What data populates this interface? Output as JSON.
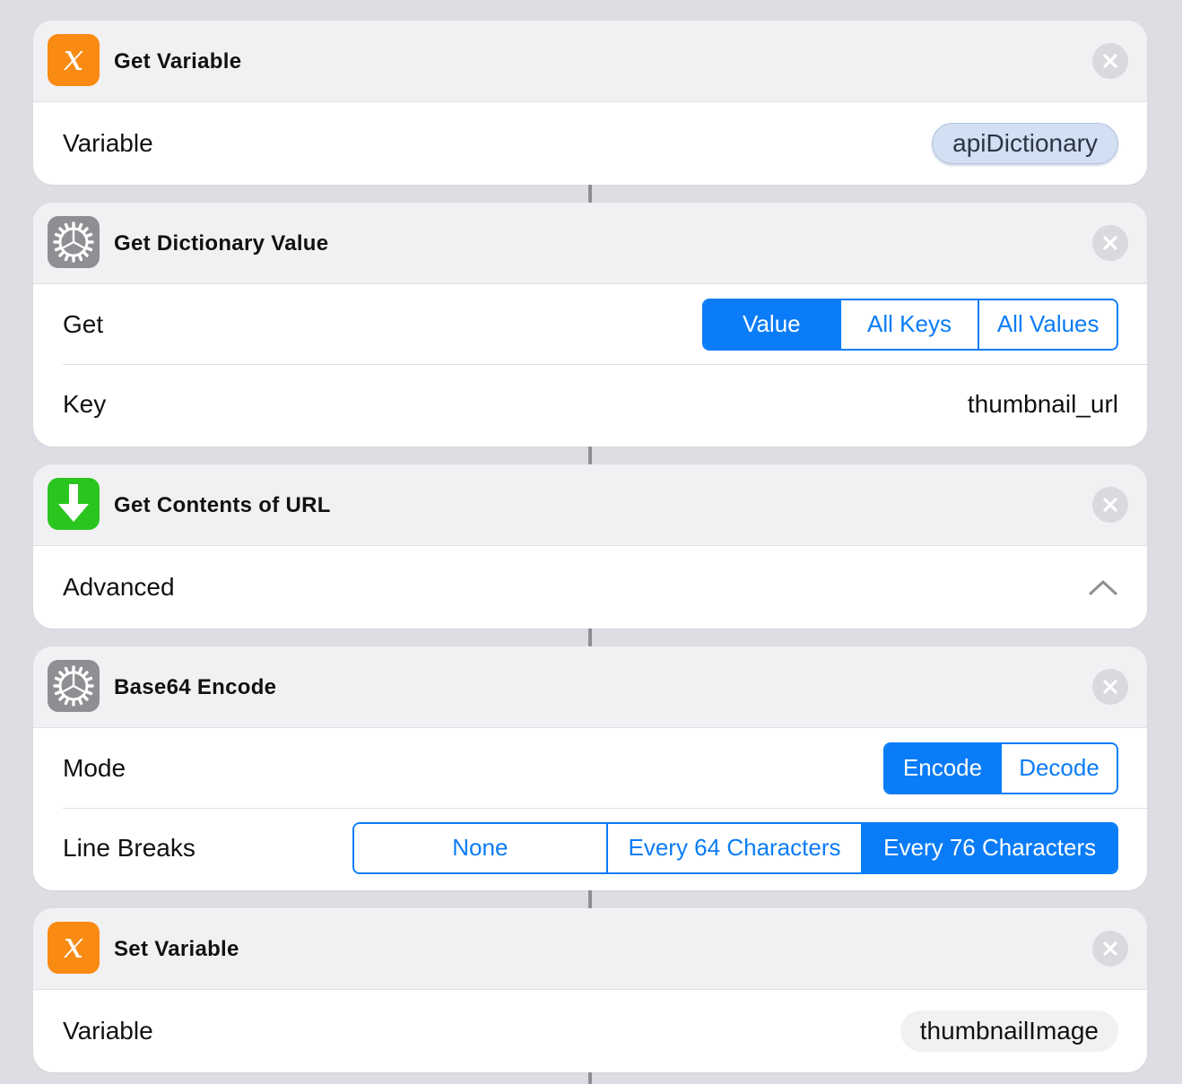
{
  "cards": [
    {
      "title": "Get Variable",
      "icon": "variable-x-icon",
      "icon_color": "#f98a12",
      "rows": [
        {
          "label": "Variable",
          "token": "apiDictionary"
        }
      ]
    },
    {
      "title": "Get Dictionary Value",
      "icon": "gear-icon",
      "icon_color": "#8e8e93",
      "rows": [
        {
          "label": "Get",
          "segments": [
            "Value",
            "All Keys",
            "All Values"
          ],
          "selected": "Value"
        },
        {
          "label": "Key",
          "value": "thumbnail_url"
        }
      ]
    },
    {
      "title": "Get Contents of URL",
      "icon": "download-arrow-icon",
      "icon_color": "#2bc51f",
      "rows": [
        {
          "label": "Advanced",
          "disclosure": "chevron-up-icon"
        }
      ]
    },
    {
      "title": "Base64 Encode",
      "icon": "gear-icon",
      "icon_color": "#8e8e93",
      "rows": [
        {
          "label": "Mode",
          "segments": [
            "Encode",
            "Decode"
          ],
          "selected": "Encode"
        },
        {
          "label": "Line Breaks",
          "segments": [
            "None",
            "Every 64 Characters",
            "Every 76 Characters"
          ],
          "selected": "Every 76 Characters"
        }
      ]
    },
    {
      "title": "Set Variable",
      "icon": "variable-x-icon",
      "icon_color": "#f98a12",
      "rows": [
        {
          "label": "Variable",
          "token": "thumbnailImage"
        }
      ]
    }
  ],
  "glyphs": {
    "variable_x": "x"
  },
  "colors": {
    "accent": "#0a7cf7",
    "background": "#dddee3",
    "card_header": "#f1f1f4",
    "connector": "#8d8e93",
    "token_blue": "#d3dff2"
  }
}
